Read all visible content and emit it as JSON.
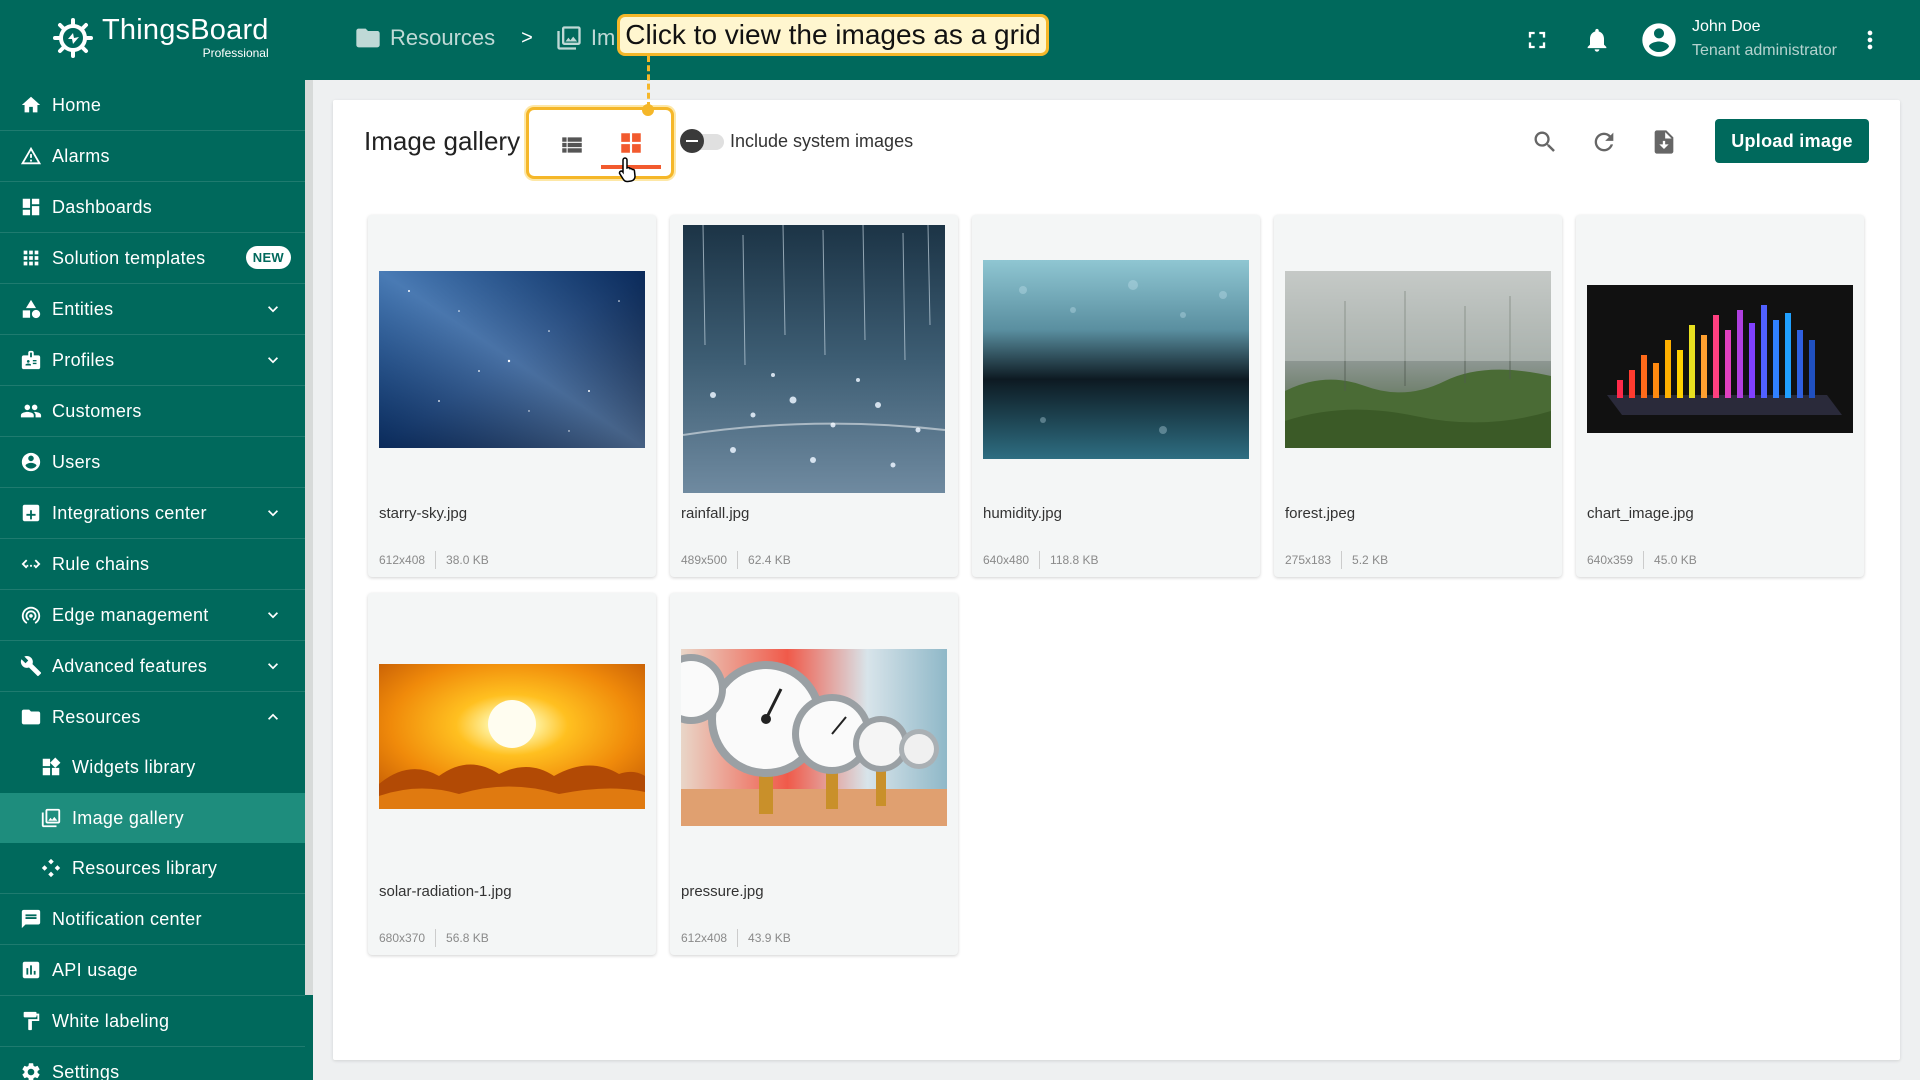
{
  "app": {
    "name": "ThingsBoard",
    "edition": "Professional"
  },
  "breadcrumb": {
    "items": [
      "Resources",
      "Im"
    ],
    "separator": ">"
  },
  "annotation": {
    "tooltip": "Click to view the images as a grid"
  },
  "user": {
    "name": "John Doe",
    "role": "Tenant administrator"
  },
  "sidebar": {
    "items": [
      {
        "label": "Home",
        "icon": "home-icon"
      },
      {
        "label": "Alarms",
        "icon": "alarm-icon"
      },
      {
        "label": "Dashboards",
        "icon": "dashboard-icon"
      },
      {
        "label": "Solution templates",
        "icon": "apps-icon",
        "badge": "NEW"
      },
      {
        "label": "Entities",
        "icon": "entities-icon",
        "expandable": true
      },
      {
        "label": "Profiles",
        "icon": "profiles-icon",
        "expandable": true
      },
      {
        "label": "Customers",
        "icon": "customers-icon"
      },
      {
        "label": "Users",
        "icon": "user-icon"
      },
      {
        "label": "Integrations center",
        "icon": "integrations-icon",
        "expandable": true
      },
      {
        "label": "Rule chains",
        "icon": "rule-chains-icon"
      },
      {
        "label": "Edge management",
        "icon": "edge-icon",
        "expandable": true
      },
      {
        "label": "Advanced features",
        "icon": "tools-icon",
        "expandable": true
      },
      {
        "label": "Resources",
        "icon": "folder-icon",
        "expanded": true
      },
      {
        "label": "Widgets library",
        "icon": "widgets-icon",
        "sub": true
      },
      {
        "label": "Image gallery",
        "icon": "image-icon",
        "sub": true,
        "active": true
      },
      {
        "label": "Resources library",
        "icon": "resources-icon",
        "sub": true
      },
      {
        "label": "Notification center",
        "icon": "notification-icon"
      },
      {
        "label": "API usage",
        "icon": "api-usage-icon"
      },
      {
        "label": "White labeling",
        "icon": "paint-icon"
      },
      {
        "label": "Settings",
        "icon": "settings-icon"
      }
    ]
  },
  "gallery": {
    "title": "Image gallery",
    "include_system_label": "Include system images",
    "include_system": false,
    "view_mode": "grid",
    "upload_label": "Upload image",
    "images": [
      {
        "name": "starry-sky.jpg",
        "dims": "612x408",
        "size": "38.0 KB"
      },
      {
        "name": "rainfall.jpg",
        "dims": "489x500",
        "size": "62.4 KB"
      },
      {
        "name": "humidity.jpg",
        "dims": "640x480",
        "size": "118.8 KB"
      },
      {
        "name": "forest.jpeg",
        "dims": "275x183",
        "size": "5.2 KB"
      },
      {
        "name": "chart_image.jpg",
        "dims": "640x359",
        "size": "45.0 KB"
      },
      {
        "name": "solar-radiation-1.jpg",
        "dims": "680x370",
        "size": "56.8 KB"
      },
      {
        "name": "pressure.jpg",
        "dims": "612x408",
        "size": "43.9 KB"
      }
    ]
  },
  "colors": {
    "primary": "#00695c",
    "accent": "#f25a2e",
    "highlight": "#f5b729"
  }
}
